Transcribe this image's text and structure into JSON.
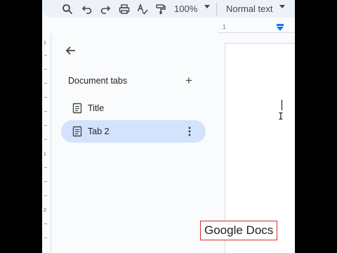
{
  "toolbar": {
    "icons": [
      "search-icon",
      "undo-icon",
      "redo-icon",
      "print-icon",
      "spellcheck-icon",
      "paint-format-icon"
    ],
    "zoom": "100%",
    "paragraph_style": "Normal text"
  },
  "ruler": {
    "label": "1",
    "vertical_labels": [
      "1",
      "1",
      "2"
    ]
  },
  "sidebar": {
    "back_icon": "arrow-back-icon",
    "title": "Document tabs",
    "add_icon": "plus-icon",
    "tabs": [
      {
        "label": "Title",
        "icon": "document-icon",
        "active": false
      },
      {
        "label": "Tab 2",
        "icon": "document-icon",
        "active": true
      }
    ]
  },
  "watermark": "Google Docs",
  "colors": {
    "toolbar_bg": "#edf2fa",
    "active_tab": "#d3e3fd",
    "ruler_marker": "#1a73e8"
  }
}
